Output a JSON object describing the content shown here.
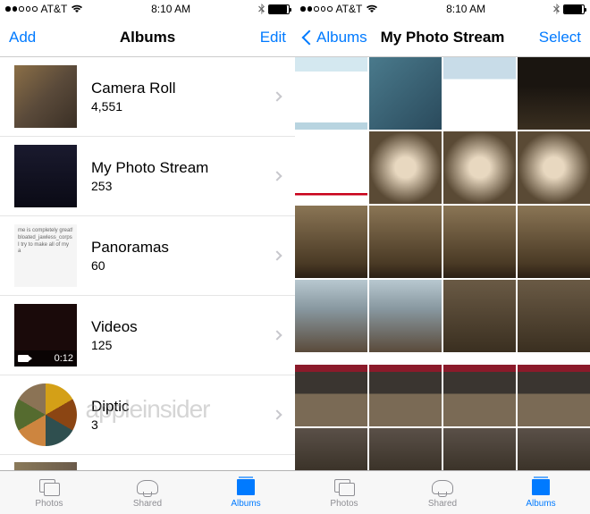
{
  "status": {
    "carrier": "AT&T",
    "time": "8:10 AM",
    "battery_pct": 90
  },
  "left": {
    "nav": {
      "left": "Add",
      "title": "Albums",
      "right": "Edit"
    },
    "albums": [
      {
        "name": "Camera Roll",
        "count": "4,551"
      },
      {
        "name": "My Photo Stream",
        "count": "253"
      },
      {
        "name": "Panoramas",
        "count": "60"
      },
      {
        "name": "Videos",
        "count": "125",
        "duration": "0:12"
      },
      {
        "name": "Diptic",
        "count": "3"
      }
    ]
  },
  "right": {
    "nav": {
      "back": "Albums",
      "title": "My Photo Stream",
      "right": "Select"
    }
  },
  "tabs": {
    "photos": "Photos",
    "shared": "Shared",
    "albums": "Albums"
  },
  "watermark": "appleinsider",
  "pano_text": "me is completely great!\nbloated_jawless_corps\nI try to make all of my a"
}
